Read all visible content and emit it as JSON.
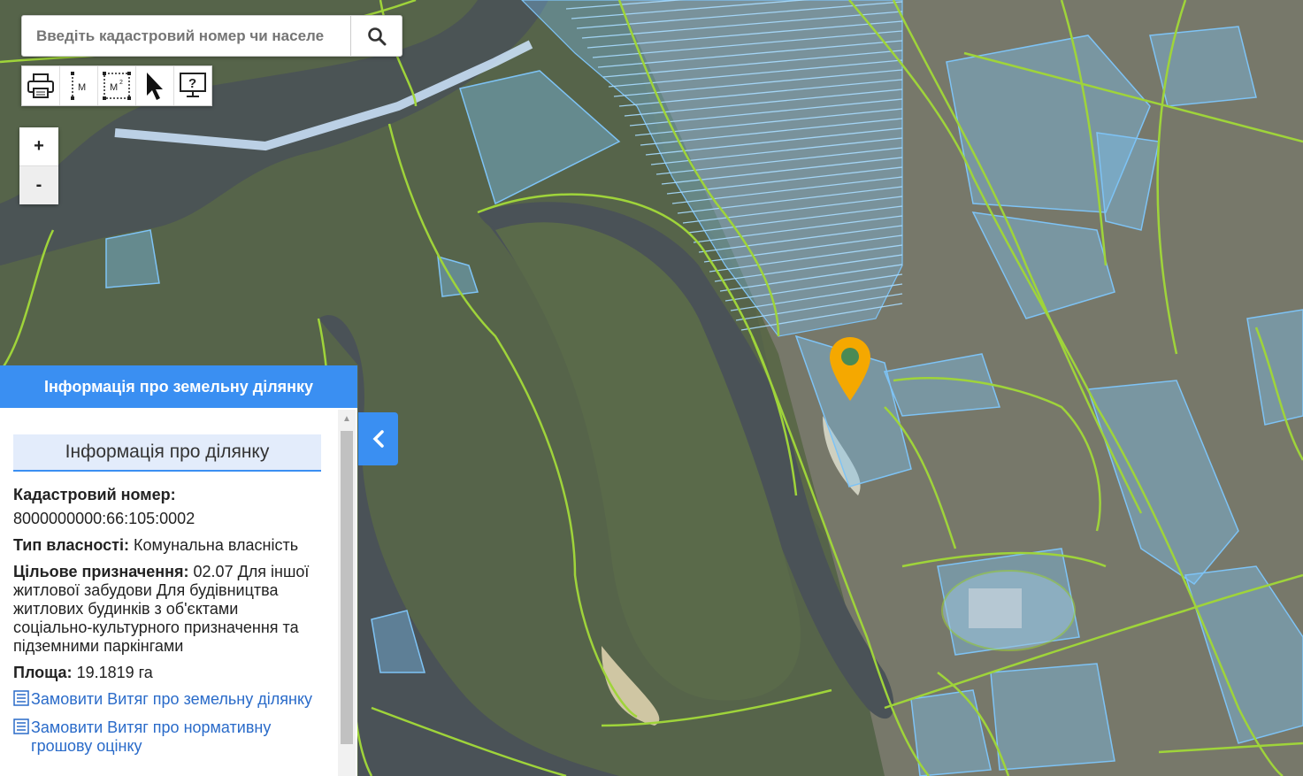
{
  "search": {
    "placeholder": "Введіть кадастровий номер чи населе"
  },
  "toolbar": {
    "print": "print-icon",
    "measure_line_label": "М",
    "measure_area_label": "М",
    "measure_area_sup": "2",
    "select": "pointer-icon",
    "help": "?"
  },
  "zoom": {
    "in": "+",
    "out": "-"
  },
  "panel": {
    "title": "Інформація про земельну ділянку",
    "section": "Інформація про ділянку",
    "cadastral_label": "Кадастровий номер:",
    "cadastral_value": "8000000000:66:105:0002",
    "ownership_label": "Тип власності:",
    "ownership_value": "Комунальна власність",
    "purpose_label": "Цільове призначення:",
    "purpose_value": "02.07 Для іншої житлової забудови Для будівництва житлових будинків з об'єктами соціально-культурного призначення та підземними паркінгами",
    "area_label": "Площа:",
    "area_value": "19.1819 га",
    "link1": "Замовити Витяг про земельну ділянку",
    "link2": "Замовити Витяг про нормативну грошову оцінку"
  },
  "colors": {
    "accent": "#3a8ff2",
    "parcel_fill": "#7ec3f5",
    "boundary": "#9fd43a",
    "pin": "#f5a800",
    "river": "#4a5257",
    "forest": "#566447"
  },
  "icons": {
    "search": "search-icon",
    "collapse": "chevron-left-icon",
    "marker": "map-marker-icon",
    "list": "list-icon"
  }
}
